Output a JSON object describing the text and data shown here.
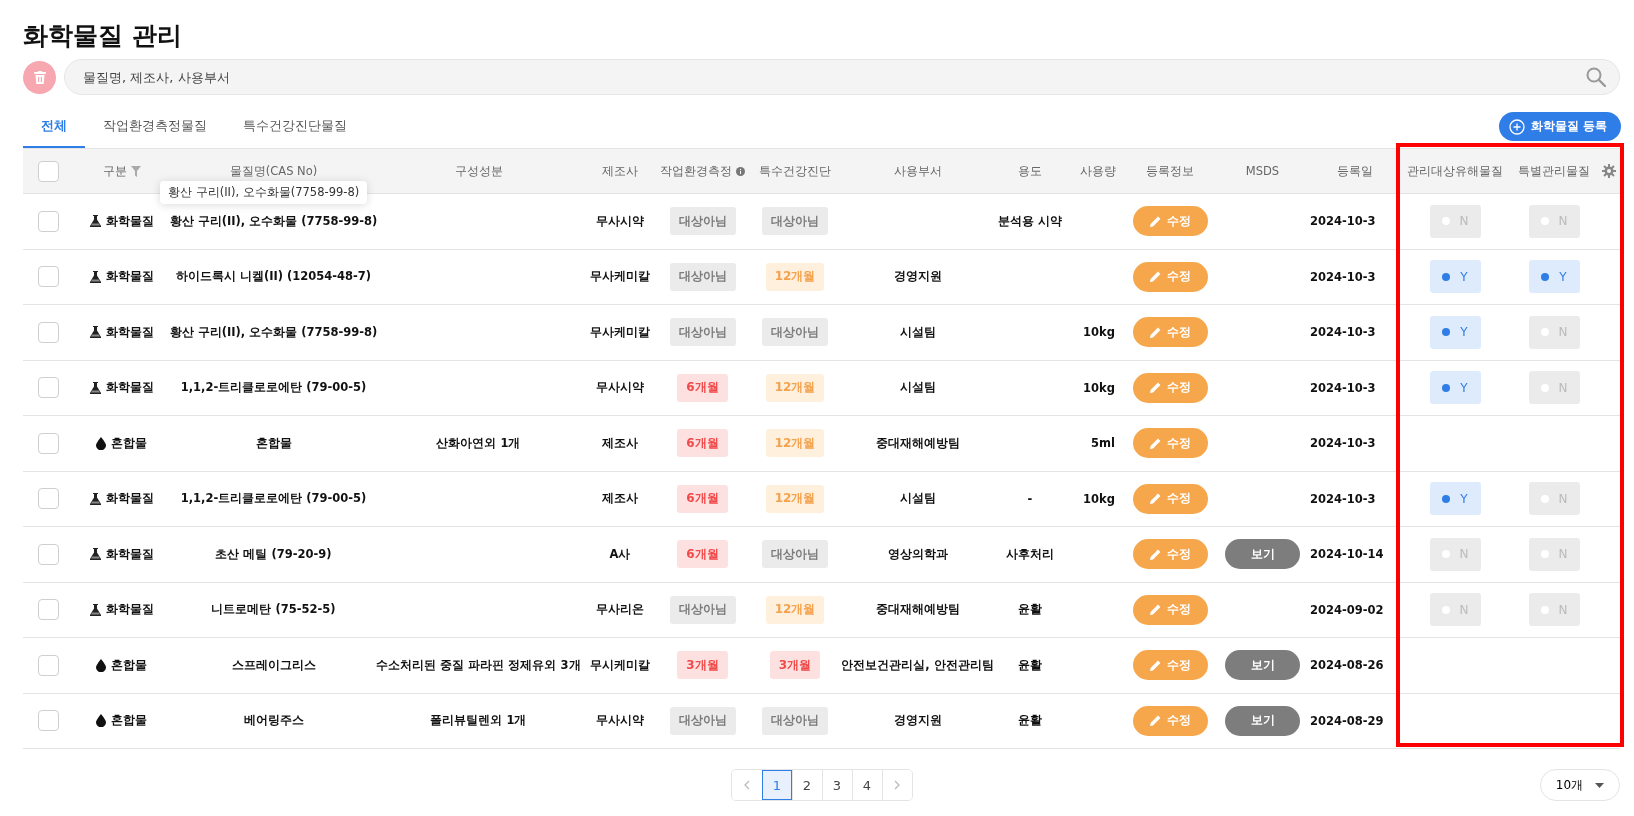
{
  "title": "화학물질 관리",
  "search": {
    "placeholder": "물질명, 제조사, 사용부서"
  },
  "tabs": [
    {
      "label": "전체",
      "selected": true
    },
    {
      "label": "작업환경측정물질",
      "selected": false
    },
    {
      "label": "특수건강진단물질",
      "selected": false
    }
  ],
  "register_button": "화학물질 등록",
  "table": {
    "header_checked": false,
    "columns": [
      "구분",
      "물질명(CAS No)",
      "구성성분",
      "제조사",
      "작업환경측정",
      "특수건강진단",
      "사용부서",
      "용도",
      "사용량",
      "등록정보",
      "MSDS",
      "등록일",
      "관리대상유해물질",
      "특별관리물질"
    ],
    "rows": [
      {
        "checked": false,
        "kind": "chemical",
        "type": "화학물질",
        "name": "황산 구리(II), 오수화물 (7758-99-8)",
        "tooltip": "황산 구리(II), 오수화물(7758-99-8)",
        "manufacturer": "무사시약",
        "work_env": {
          "kind": "neutral",
          "label": "대상아님"
        },
        "health": {
          "kind": "neutral",
          "label": "대상아님"
        },
        "purpose": "분석용 시약",
        "edit": "수정",
        "date": "2024-10-3",
        "managed": {
          "label": "N",
          "on": false
        },
        "special": {
          "label": "N",
          "on": false
        }
      },
      {
        "checked": false,
        "kind": "chemical",
        "type": "화학물질",
        "name": "하이드록시 니켈(II) (12054-48-7)",
        "manufacturer": "무사케미칼",
        "work_env": {
          "kind": "neutral",
          "label": "대상아님"
        },
        "health": {
          "kind": "warning",
          "label": "12개월"
        },
        "department": "경영지원",
        "edit": "수정",
        "date": "2024-10-3",
        "managed": {
          "label": "Y",
          "on": true
        },
        "special": {
          "label": "Y",
          "on": true
        }
      },
      {
        "checked": false,
        "kind": "chemical",
        "type": "화학물질",
        "name": "황산 구리(II), 오수화물 (7758-99-8)",
        "manufacturer": "무사케미칼",
        "work_env": {
          "kind": "neutral",
          "label": "대상아님"
        },
        "health": {
          "kind": "neutral",
          "label": "대상아님"
        },
        "department": "시설팀",
        "amount": "10kg",
        "edit": "수정",
        "date": "2024-10-3",
        "managed": {
          "label": "Y",
          "on": true
        },
        "special": {
          "label": "N",
          "on": false
        }
      },
      {
        "checked": false,
        "kind": "chemical",
        "type": "화학물질",
        "name": "1,1,2-트리클로로에탄 (79-00-5)",
        "manufacturer": "무사시약",
        "work_env": {
          "kind": "danger",
          "label": "6개월"
        },
        "health": {
          "kind": "warning",
          "label": "12개월"
        },
        "department": "시설팀",
        "amount": "10kg",
        "edit": "수정",
        "date": "2024-10-3",
        "managed": {
          "label": "Y",
          "on": true
        },
        "special": {
          "label": "N",
          "on": false
        }
      },
      {
        "checked": false,
        "kind": "mixture",
        "type": "혼합물",
        "name": "혼합물",
        "components": "산화아연외 1개",
        "manufacturer": "제조사",
        "work_env": {
          "kind": "danger",
          "label": "6개월"
        },
        "health": {
          "kind": "warning",
          "label": "12개월"
        },
        "department": "중대재해예방팀",
        "amount": "5ml",
        "edit": "수정",
        "date": "2024-10-3"
      },
      {
        "checked": false,
        "kind": "chemical",
        "type": "화학물질",
        "name": "1,1,2-트리클로로에탄 (79-00-5)",
        "manufacturer": "제조사",
        "work_env": {
          "kind": "danger",
          "label": "6개월"
        },
        "health": {
          "kind": "warning",
          "label": "12개월"
        },
        "department": "시설팀",
        "purpose": "-",
        "amount": "10kg",
        "edit": "수정",
        "date": "2024-10-3",
        "managed": {
          "label": "Y",
          "on": true
        },
        "special": {
          "label": "N",
          "on": false
        }
      },
      {
        "checked": false,
        "kind": "chemical",
        "type": "화학물질",
        "name": "초산 메틸 (79-20-9)",
        "manufacturer": "A사",
        "work_env": {
          "kind": "danger",
          "label": "6개월"
        },
        "health": {
          "kind": "neutral",
          "label": "대상아님"
        },
        "department": "영상의학과",
        "purpose": "사후처리",
        "edit": "수정",
        "msds": "보기",
        "date": "2024-10-14",
        "managed": {
          "label": "N",
          "on": false
        },
        "special": {
          "label": "N",
          "on": false
        }
      },
      {
        "checked": false,
        "kind": "chemical",
        "type": "화학물질",
        "name": "니트로메탄 (75-52-5)",
        "manufacturer": "무사리온",
        "work_env": {
          "kind": "neutral",
          "label": "대상아님"
        },
        "health": {
          "kind": "warning",
          "label": "12개월"
        },
        "department": "중대재해예방팀",
        "purpose": "윤활",
        "edit": "수정",
        "date": "2024-09-02",
        "managed": {
          "label": "N",
          "on": false
        },
        "special": {
          "label": "N",
          "on": false
        }
      },
      {
        "checked": false,
        "kind": "mixture",
        "type": "혼합물",
        "name": "스프레이그리스",
        "components": "수소처리된 중질 파라핀 정제유외 3개",
        "manufacturer": "무시케미칼",
        "work_env": {
          "kind": "danger",
          "label": "3개월"
        },
        "health": {
          "kind": "danger",
          "label": "3개월"
        },
        "department": "안전보건관리실, 안전관리팀",
        "purpose": "윤활",
        "edit": "수정",
        "msds": "보기",
        "date": "2024-08-26"
      },
      {
        "checked": false,
        "kind": "mixture",
        "type": "혼합물",
        "name": "베어링주스",
        "components": "폴리뷰틸렌외 1개",
        "manufacturer": "무사시약",
        "work_env": {
          "kind": "neutral",
          "label": "대상아님"
        },
        "health": {
          "kind": "neutral",
          "label": "대상아님"
        },
        "department": "경영지원",
        "purpose": "윤활",
        "edit": "수정",
        "msds": "보기",
        "date": "2024-08-29"
      }
    ]
  },
  "pagination": {
    "pages": [
      {
        "label": "1",
        "selected": true
      },
      {
        "label": "2",
        "selected": false
      },
      {
        "label": "3",
        "selected": false
      },
      {
        "label": "4",
        "selected": false
      }
    ],
    "page_size": "10개"
  },
  "annotation": {
    "kind": "highlight-frame"
  }
}
